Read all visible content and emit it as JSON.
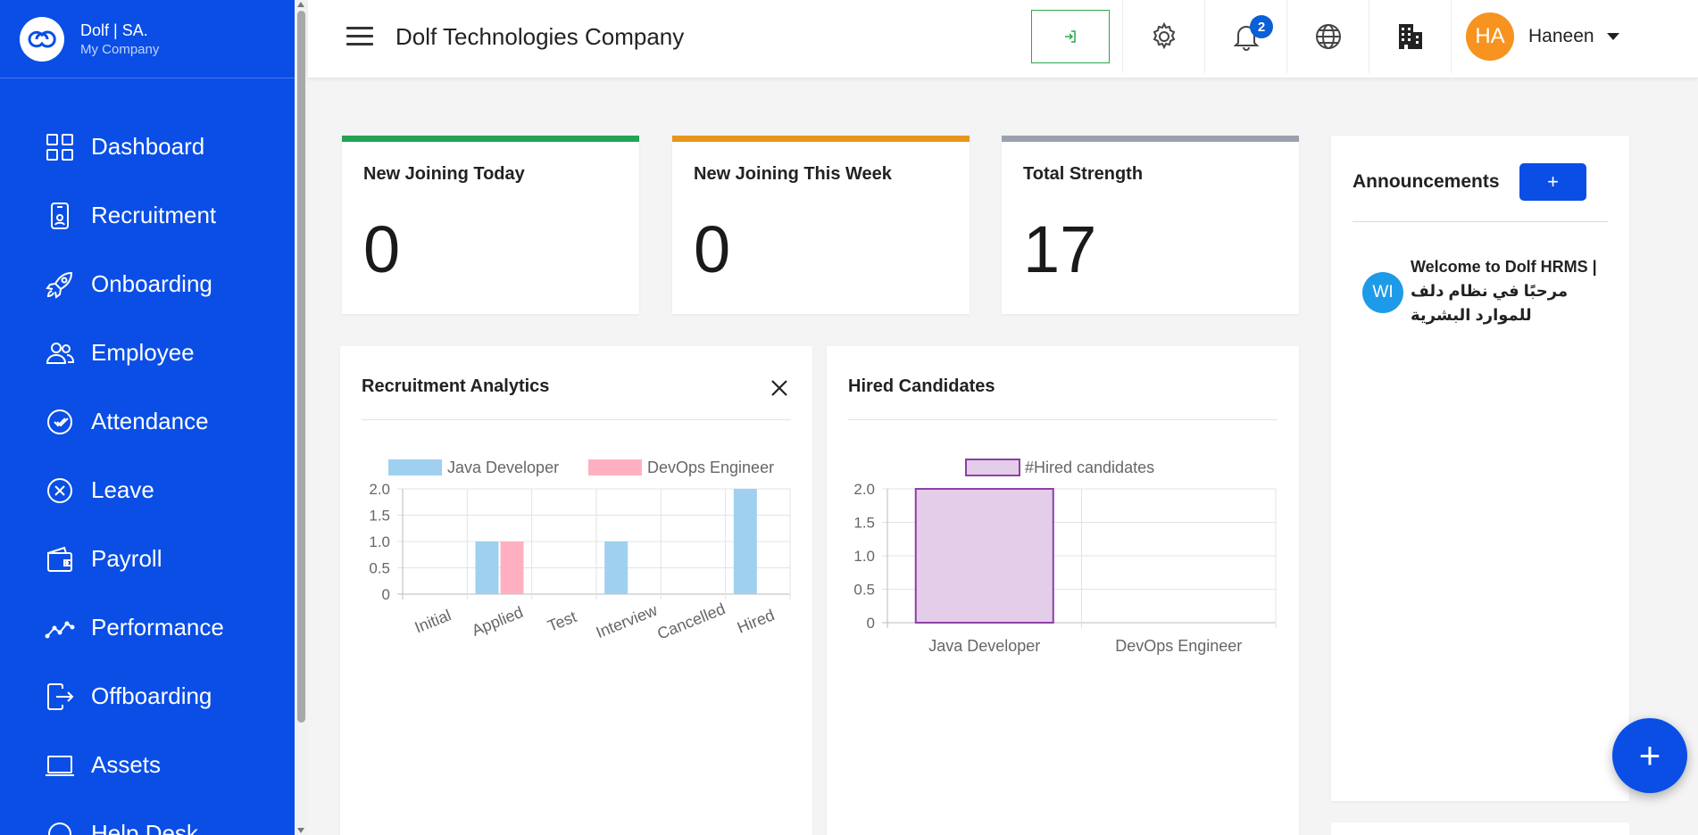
{
  "brand": {
    "name": "Dolf | SA.",
    "subtitle": "My Company"
  },
  "sidebar": {
    "items": [
      {
        "label": "Dashboard",
        "icon": "dashboard-icon"
      },
      {
        "label": "Recruitment",
        "icon": "phone-badge-icon"
      },
      {
        "label": "Onboarding",
        "icon": "rocket-icon"
      },
      {
        "label": "Employee",
        "icon": "people-icon"
      },
      {
        "label": "Attendance",
        "icon": "check-circle-icon"
      },
      {
        "label": "Leave",
        "icon": "x-circle-icon"
      },
      {
        "label": "Payroll",
        "icon": "wallet-icon"
      },
      {
        "label": "Performance",
        "icon": "trend-line-icon"
      },
      {
        "label": "Offboarding",
        "icon": "exit-icon"
      },
      {
        "label": "Assets",
        "icon": "laptop-icon"
      },
      {
        "label": "Help Desk",
        "icon": "headset-icon"
      }
    ]
  },
  "header": {
    "company": "Dolf Technologies Company",
    "notification_count": "2",
    "user": {
      "initials": "HA",
      "name": "Haneen"
    }
  },
  "stats": [
    {
      "title": "New Joining Today",
      "value": "0",
      "color": "#23a455"
    },
    {
      "title": "New Joining This Week",
      "value": "0",
      "color": "#e8961a"
    },
    {
      "title": "Total Strength",
      "value": "17",
      "color": "#9aa0ae"
    }
  ],
  "panels": {
    "recruitment_title": "Recruitment Analytics",
    "hired_title": "Hired Candidates"
  },
  "chart_data": [
    {
      "type": "bar",
      "title": "Recruitment Analytics",
      "categories": [
        "Initial",
        "Applied",
        "Test",
        "Interview",
        "Cancelled",
        "Hired"
      ],
      "series": [
        {
          "name": "Java Developer",
          "values": [
            0,
            1,
            0,
            1,
            0,
            2
          ],
          "color": "#9fd0f0"
        },
        {
          "name": "DevOps Engineer",
          "values": [
            0,
            1,
            0,
            0,
            0,
            0
          ],
          "color": "#ffb0c0"
        }
      ],
      "ylim": [
        0,
        2
      ],
      "yticks": [
        "0",
        "0.5",
        "1.0",
        "1.5",
        "2.0"
      ],
      "grid": true,
      "legend": "top"
    },
    {
      "type": "bar",
      "title": "Hired Candidates",
      "categories": [
        "Java Developer",
        "DevOps Engineer"
      ],
      "series": [
        {
          "name": "#Hired candidates",
          "values": [
            2,
            0
          ],
          "color": "#e3cde9",
          "border": "#8e3fa8"
        }
      ],
      "ylim": [
        0,
        2
      ],
      "yticks": [
        "0",
        "0.5",
        "1.0",
        "1.5",
        "2.0"
      ],
      "grid": true,
      "legend": "top"
    }
  ],
  "announcements": {
    "title": "Announcements",
    "add_label": "+",
    "items": [
      {
        "initials": "WI",
        "text": "Welcome to Dolf HRMS | مرحبًا في نظام دلف للموارد البشرية"
      }
    ]
  },
  "fab_label": "+"
}
